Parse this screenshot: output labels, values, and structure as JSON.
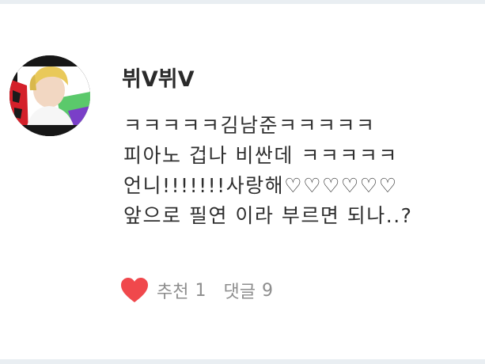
{
  "comment": {
    "username": "뷔V뷔V",
    "avatar_icon": "profile-photo-icon",
    "lines": [
      "ㅋㅋㅋㅋㅋ김남준ㅋㅋㅋㅋㅋ",
      "피아노 겁나 비싼데 ㅋㅋㅋㅋㅋ",
      "언니!!!!!!!사랑해♡♡♡♡♡♡",
      "앞으로 필연 이라 부르면 되나..?"
    ],
    "like_label": "추천",
    "like_count": "1",
    "reply_label": "댓글",
    "reply_count": "9",
    "heart_icon": "heart-icon",
    "heart_color": "#f0484c"
  }
}
